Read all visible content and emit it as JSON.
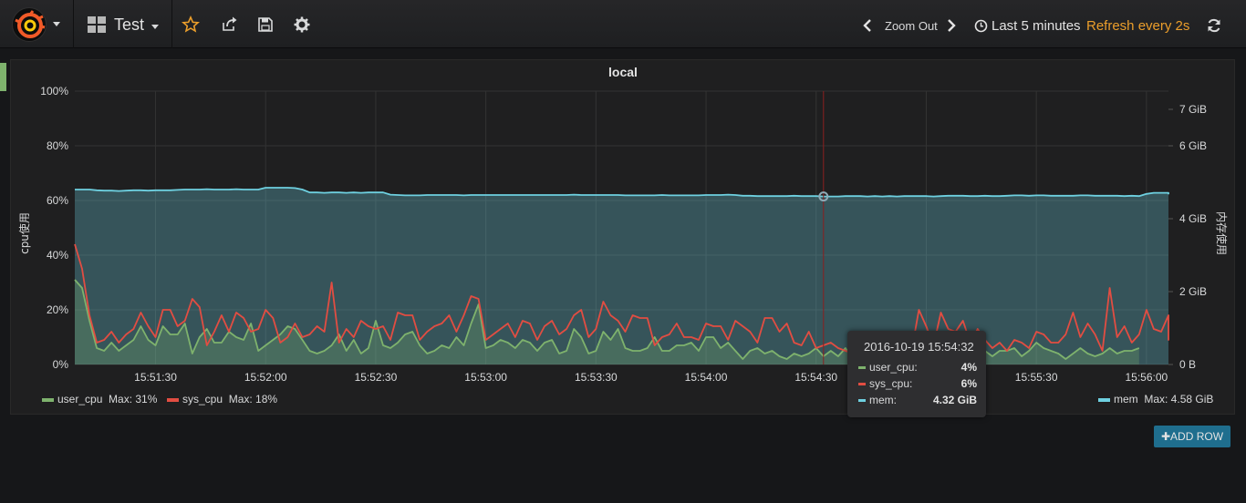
{
  "navbar": {
    "dashboard_title": "Test",
    "zoom_out_label": "Zoom Out",
    "time_range_label": "Last 5 minutes",
    "refresh_label": "Refresh every 2s",
    "icons": [
      "grafana-logo-icon",
      "dashboard-grid-icon",
      "star-icon",
      "share-icon",
      "save-icon",
      "gear-icon",
      "chevron-left-icon",
      "chevron-right-icon",
      "clock-icon",
      "refresh-icon"
    ]
  },
  "panel": {
    "title": "local",
    "left_axis_label": "cpu使用",
    "right_axis_label": "内存使用"
  },
  "legend": {
    "user_cpu": {
      "name": "user_cpu",
      "max_label": "Max: 31%"
    },
    "sys_cpu": {
      "name": "sys_cpu",
      "max_label": "Max: 18%"
    },
    "mem": {
      "name": "mem",
      "max_label": "Max: 4.58 GiB"
    }
  },
  "tooltip": {
    "time": "2016-10-19 15:54:32",
    "rows": [
      {
        "name": "user_cpu:",
        "value": "4%"
      },
      {
        "name": "sys_cpu:",
        "value": "6%"
      },
      {
        "name": "mem:",
        "value": "4.32 GiB"
      }
    ]
  },
  "add_row_label": "ADD ROW",
  "colors": {
    "user_cpu": "#7eb26d",
    "sys_cpu": "#e24d42",
    "mem": "#6ed0e0",
    "refresh": "#eb9e2b",
    "add_row": "#1f6e8e"
  },
  "chart_data": {
    "type": "line",
    "title": "local",
    "ylabel": "cpu使用",
    "y2label": "内存使用",
    "ylim": [
      0,
      100
    ],
    "y2lim": [
      0,
      7.5
    ],
    "xlim": [
      "15:51:08",
      "15:56:06"
    ],
    "x_ticks": [
      "15:51:30",
      "15:52:00",
      "15:52:30",
      "15:53:00",
      "15:53:30",
      "15:54:00",
      "15:54:30",
      "15:55:00",
      "15:55:30",
      "15:56:00"
    ],
    "y_ticks": [
      "0%",
      "20%",
      "40%",
      "60%",
      "80%",
      "100%"
    ],
    "y2_ticks": [
      "0 B",
      "2 GiB",
      "4 GiB",
      "6 GiB",
      "7 GiB"
    ],
    "y2_tick_values": [
      0,
      2,
      4,
      6,
      7
    ],
    "grid": true,
    "legend": "bottom",
    "crosshair_time": "15:54:32",
    "series": [
      {
        "name": "user_cpu",
        "axis": "left",
        "fill": true,
        "start": "15:51:08",
        "step_s": 2,
        "values": [
          31,
          28,
          16,
          6,
          5,
          8,
          5,
          7,
          9,
          14,
          9,
          7,
          14,
          11,
          11,
          15,
          4,
          10,
          13,
          8,
          8,
          12,
          10,
          9,
          15,
          5,
          7,
          9,
          11,
          14,
          13,
          9,
          5,
          4,
          5,
          7,
          11,
          5,
          9,
          4,
          6,
          16,
          7,
          6,
          8,
          11,
          12,
          7,
          4,
          5,
          7,
          6,
          10,
          7,
          15,
          22,
          6,
          7,
          9,
          8,
          6,
          9,
          8,
          5,
          8,
          9,
          4,
          5,
          13,
          10,
          4,
          5,
          12,
          9,
          13,
          6,
          5,
          5,
          6,
          10,
          5,
          5,
          7,
          7,
          8,
          5,
          10,
          10,
          6,
          8,
          5,
          2,
          5,
          6,
          4,
          5,
          3,
          2,
          4,
          3,
          4,
          6,
          3,
          5,
          3,
          6,
          2,
          5,
          4,
          3,
          4,
          6,
          5,
          4,
          3,
          5,
          6,
          4,
          5,
          6,
          4,
          5,
          8,
          9,
          5,
          3,
          5,
          5,
          6,
          3,
          5,
          8,
          6,
          5,
          4,
          2,
          4,
          6,
          4,
          3,
          4,
          6,
          4,
          5,
          5,
          6
        ]
      },
      {
        "name": "sys_cpu",
        "axis": "left",
        "fill": false,
        "start": "15:51:08",
        "step_s": 2,
        "values": [
          44,
          35,
          18,
          8,
          9,
          12,
          8,
          11,
          13,
          19,
          14,
          10,
          20,
          20,
          14,
          16,
          24,
          21,
          7,
          12,
          18,
          12,
          19,
          17,
          12,
          13,
          20,
          17,
          8,
          10,
          15,
          10,
          11,
          14,
          12,
          30,
          8,
          13,
          10,
          16,
          14,
          13,
          14,
          9,
          19,
          18,
          18,
          9,
          12,
          14,
          15,
          18,
          12,
          18,
          25,
          24,
          9,
          11,
          13,
          15,
          10,
          16,
          15,
          9,
          14,
          16,
          11,
          13,
          18,
          20,
          10,
          13,
          23,
          18,
          16,
          12,
          18,
          17,
          17,
          7,
          10,
          11,
          15,
          10,
          10,
          9,
          15,
          14,
          14,
          9,
          16,
          14,
          12,
          8,
          17,
          17,
          12,
          15,
          8,
          7,
          12,
          6,
          7,
          8,
          6,
          5,
          4,
          6,
          8,
          6,
          5,
          8,
          6,
          4,
          5,
          20,
          14,
          7,
          19,
          13,
          12,
          16,
          8,
          13,
          9,
          6,
          8,
          5,
          9,
          8,
          6,
          12,
          11,
          8,
          8,
          11,
          19,
          10,
          15,
          11,
          5,
          28,
          10,
          14,
          8,
          11,
          20,
          13,
          12,
          18,
          9,
          11
        ]
      },
      {
        "name": "mem",
        "axis": "right",
        "fill": true,
        "start": "15:51:08",
        "step_s": 2,
        "values": [
          4.8,
          4.8,
          4.8,
          4.78,
          4.77,
          4.77,
          4.76,
          4.77,
          4.78,
          4.78,
          4.77,
          4.78,
          4.78,
          4.78,
          4.79,
          4.8,
          4.8,
          4.8,
          4.81,
          4.8,
          4.8,
          4.8,
          4.81,
          4.8,
          4.8,
          4.8,
          4.85,
          4.85,
          4.85,
          4.85,
          4.84,
          4.8,
          4.72,
          4.72,
          4.71,
          4.72,
          4.72,
          4.71,
          4.72,
          4.71,
          4.72,
          4.72,
          4.72,
          4.66,
          4.65,
          4.64,
          4.64,
          4.64,
          4.65,
          4.65,
          4.65,
          4.65,
          4.65,
          4.64,
          4.65,
          4.65,
          4.65,
          4.65,
          4.65,
          4.65,
          4.65,
          4.65,
          4.65,
          4.65,
          4.65,
          4.65,
          4.65,
          4.65,
          4.66,
          4.65,
          4.65,
          4.65,
          4.65,
          4.65,
          4.65,
          4.64,
          4.64,
          4.64,
          4.64,
          4.64,
          4.65,
          4.64,
          4.64,
          4.64,
          4.64,
          4.64,
          4.65,
          4.65,
          4.65,
          4.66,
          4.65,
          4.63,
          4.63,
          4.62,
          4.62,
          4.62,
          4.62,
          4.62,
          4.63,
          4.62,
          4.62,
          4.62,
          4.61,
          4.61,
          4.61,
          4.62,
          4.62,
          4.62,
          4.61,
          4.62,
          4.61,
          4.62,
          4.61,
          4.62,
          4.62,
          4.62,
          4.62,
          4.61,
          4.62,
          4.63,
          4.63,
          4.63,
          4.62,
          4.62,
          4.63,
          4.62,
          4.62,
          4.63,
          4.64,
          4.64,
          4.63,
          4.64,
          4.64,
          4.63,
          4.63,
          4.63,
          4.63,
          4.64,
          4.64,
          4.63,
          4.63,
          4.63,
          4.63,
          4.62,
          4.63,
          4.62,
          4.68,
          4.71,
          4.71,
          4.71,
          4.68,
          4.67
        ]
      }
    ]
  }
}
